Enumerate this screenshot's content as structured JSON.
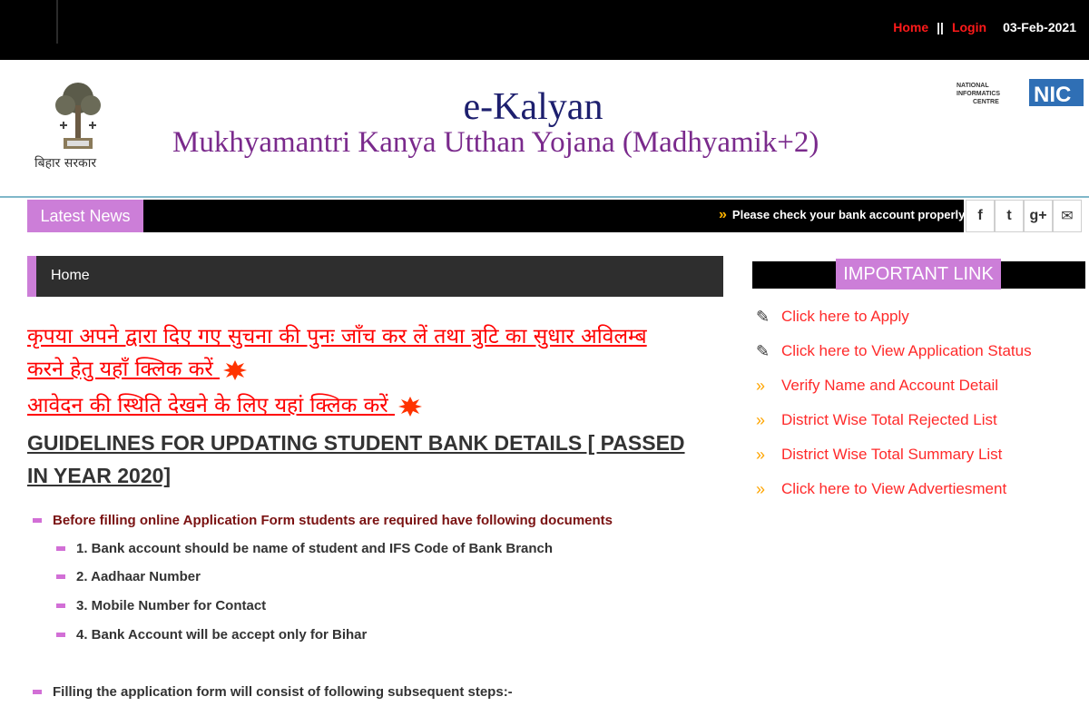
{
  "topbar": {
    "home": "Home",
    "separator": "||",
    "login": "Login",
    "date": "03-Feb-2021"
  },
  "header": {
    "emblem_text": "बिहार सरकार",
    "title": "e-Kalyan",
    "subtitle": "Mukhyamantri Kanya Utthan Yojana (Madhyamik+2)",
    "nic_small": "NATIONAL INFORMATICS CENTRE",
    "nic_big": "NIC"
  },
  "news": {
    "label": "Latest News",
    "ticker": "Please check your bank account properly"
  },
  "social": {
    "facebook": "f",
    "twitter": "t",
    "gplus": "g+",
    "email": "✉"
  },
  "breadcrumb": {
    "home": "Home"
  },
  "notices": {
    "line1": "कृपया अपने द्वारा दिए गए सुचना की पुनः जाँच कर लें तथा त्रुटि का सुधार अविलम्ब",
    "line2": "करने हेतु यहाँ क्लिक करें",
    "line3": "आवेदन की स्थिति देखने के लिए यहां क्लिक करें"
  },
  "guidelines": {
    "heading": "GUIDELINES FOR UPDATING STUDENT BANK DETAILS [ PASSED IN YEAR 2020]",
    "intro": "Before filling online Application Form students are required have following documents",
    "items": [
      "1. Bank account should be name of student and IFS Code of Bank Branch",
      "2. Aadhaar Number",
      "3. Mobile Number for Contact",
      "4. Bank Account will be accept only for Bihar"
    ],
    "steps": "Filling the application form will consist of following subsequent steps:-"
  },
  "important_links": {
    "label": "IMPORTANT LINK",
    "items": [
      {
        "icon": "pen-icon",
        "label": "Click here to Apply"
      },
      {
        "icon": "pen-icon",
        "label": "Click here to View Application Status"
      },
      {
        "icon": "chevron-icon",
        "label": "Verify Name and Account Detail"
      },
      {
        "icon": "chevron-icon",
        "label": "District Wise Total Rejected List"
      },
      {
        "icon": "chevron-icon",
        "label": "District Wise Total Summary List"
      },
      {
        "icon": "chevron-icon",
        "label": "Click here to View Advertiesment"
      }
    ]
  },
  "colors": {
    "accent": "#cc7ed8",
    "link_red": "#ff0000",
    "title_blue": "#1d1f6e",
    "subtitle_purple": "#7a2a8c"
  }
}
